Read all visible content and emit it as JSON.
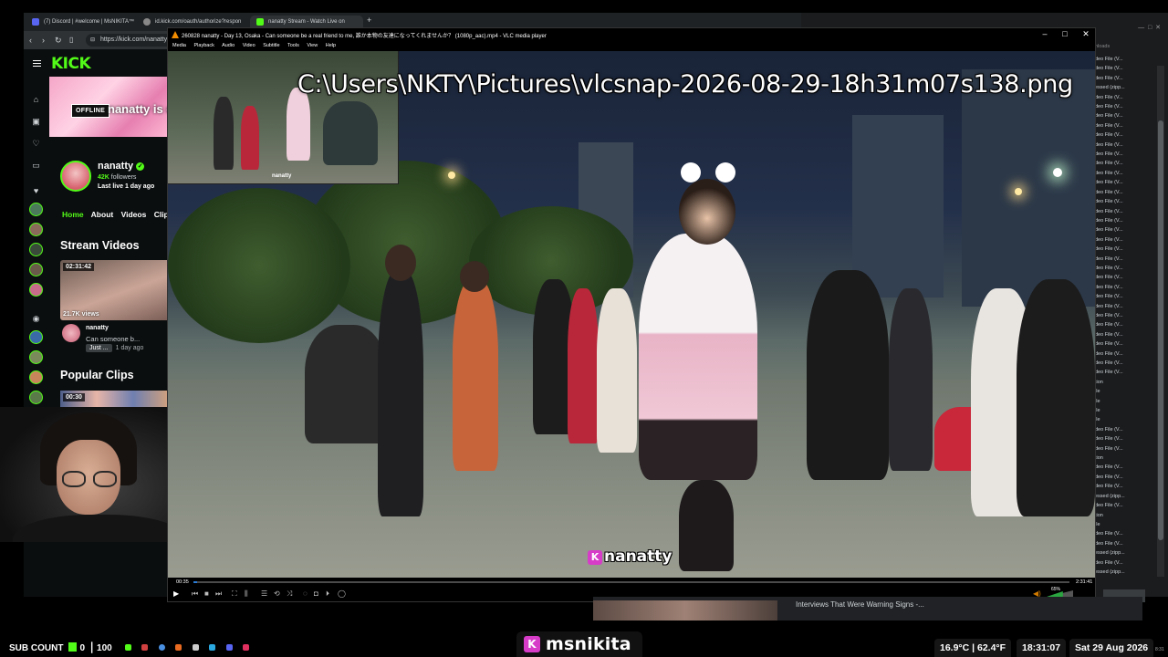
{
  "browser": {
    "tabs": [
      {
        "label": "(7) Discord | #welcome | MsNIKITA™",
        "color": "#5865f2"
      },
      {
        "label": "id.kick.com/oauth/authorize?respon",
        "color": "#888888"
      },
      {
        "label": "nanatty Stream - Watch Live on",
        "color": "#53fc18"
      }
    ],
    "new_tab": "+",
    "url": "https://kick.com/nanatty"
  },
  "kick": {
    "logo": "KICK",
    "offline_badge": "OFFLINE",
    "banner_text": "nanatty is o",
    "channel_name": "nanatty",
    "followers_count": "42K",
    "followers_label": "followers",
    "last_live": "Last live 1 day ago",
    "tabs": [
      "Home",
      "About",
      "Videos",
      "Clip"
    ],
    "stream_videos_heading": "Stream Videos",
    "video": {
      "duration": "02:31:42",
      "views": "21.7K views",
      "channel": "nanatty",
      "title": "Can someone b...",
      "badge": "Just ...",
      "age": "1 day ago"
    },
    "popular_clips_heading": "Popular Clips",
    "clip_duration": "00:30"
  },
  "vlc": {
    "title": "260828 nanatty - Day 13, Osaka - Can someone be a real friend to me, 誰か本物の友達になってくれませんか？ (1080p_aac).mp4 - VLC media player",
    "menu": [
      "Media",
      "Playback",
      "Audio",
      "Video",
      "Subtitle",
      "Tools",
      "View",
      "Help"
    ],
    "snapshot_path": "C:\\Users\\NKTY\\Pictures\\vlcsnap-2026-08-29-18h31m07s138.png",
    "inset_watermark": "nanatty",
    "watermark": "nanatty",
    "time_elapsed": "00:35",
    "time_total": "2:31:41",
    "progress": 0.004,
    "volume": "65%",
    "volume_level": 0.65
  },
  "right_window": {
    "items": [
      "deo File (V...",
      "deo File (V...",
      "deo File (V...",
      "essed (zipp...",
      "deo File (V...",
      "deo File (V...",
      "deo File (V...",
      "deo File (V...",
      "deo File (V...",
      "deo File (V...",
      "deo File (V...",
      "deo File (V...",
      "deo File (V...",
      "deo File (V...",
      "deo File (V...",
      "deo File (V...",
      "deo File (V...",
      "deo File (V...",
      "deo File (V...",
      "deo File (V...",
      "deo File (V...",
      "deo File (V...",
      "deo File (V...",
      "deo File (V...",
      "deo File (V...",
      "deo File (V...",
      "deo File (V...",
      "deo File (V...",
      "deo File (V...",
      "deo File (V...",
      "deo File (V...",
      "deo File (V...",
      "deo File (V...",
      "deo File (V...",
      "tion",
      "ile",
      "ile",
      "ile",
      "ile",
      "deo File (V...",
      "deo File (V...",
      "deo File (V...",
      "tion",
      "deo File (V...",
      "deo File (V...",
      "deo File (V...",
      "essed (zipp...",
      "deo File (V...",
      "tion",
      "ile",
      "deo File (V...",
      "deo File (V...",
      "essed (zipp...",
      "deo File (V...",
      "essed (zipp..."
    ],
    "header": "nloads"
  },
  "bottom_panel": {
    "text": "Interviews That Were Warning Signs -..."
  },
  "taskbar": {
    "sub_count_label": "SUB COUNT",
    "sub_count_value": "0",
    "sub_count_goal": "100",
    "brand": "msnikita",
    "temperature": "16.9°C | 62.4°F",
    "time": "18:31:07",
    "date": "Sat 29 Aug 2026",
    "tiny_clock": "8:31"
  },
  "colors": {
    "kick_green": "#53fc18",
    "kick_pink": "#d63cc8",
    "vlc_seek": "#2a7bd5"
  }
}
